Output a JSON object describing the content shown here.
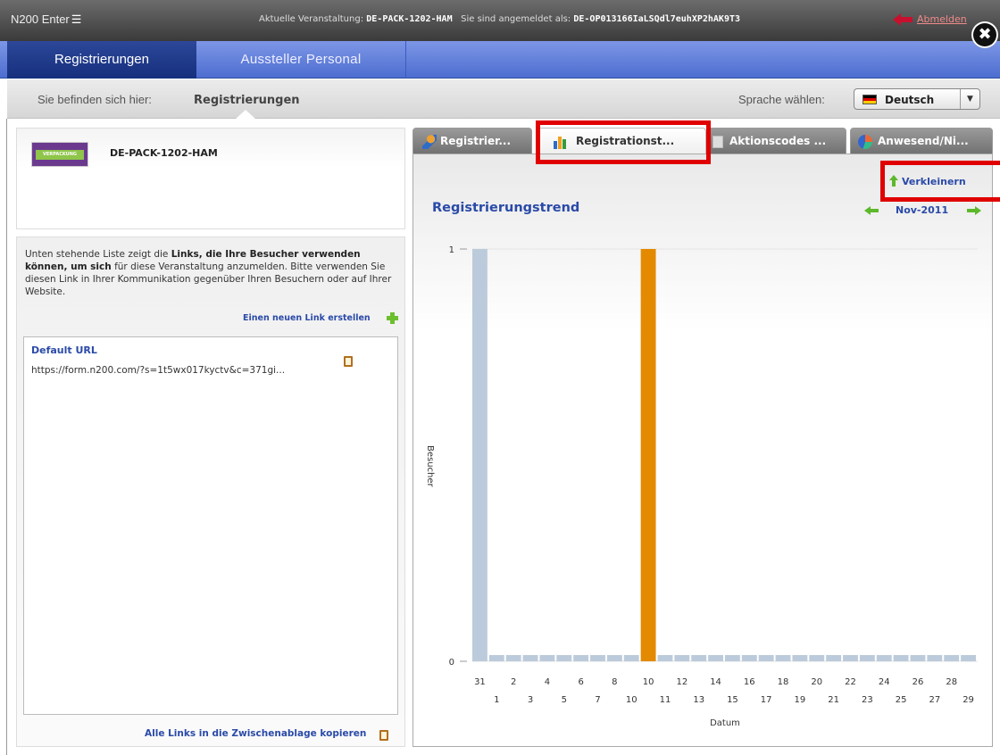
{
  "header": {
    "app_name": "N200 Enter",
    "event_label": "Aktuelle Veranstaltung:",
    "event_code": "DE-PACK-1202-HAM",
    "user_label": "Sie sind angemeldet als:",
    "user_code": "DE-OP013166IaLSQdl7euhXP2hAK9T3",
    "logout": "Abmelden",
    "close_glyph": "✖"
  },
  "nav": {
    "tabs": [
      {
        "label": "Registrierungen",
        "active": true
      },
      {
        "label": "Aussteller Personal",
        "active": false
      }
    ]
  },
  "breadcrumb": {
    "label": "Sie befinden sich hier:",
    "current": "Registrierungen"
  },
  "language": {
    "label": "Sprache wählen:",
    "value": "Deutsch"
  },
  "event_card": {
    "logo_text": "VERPACKUNG",
    "name": "DE-PACK-1202-HAM"
  },
  "links_panel": {
    "desc_part1": "Unten stehende Liste zeigt die ",
    "desc_bold": "Links, die Ihre Besucher verwenden können, um sich",
    "desc_part2": " für diese Veranstaltung anzumelden. Bitte verwenden Sie diesen Link in Ihrer Kommunikation gegenüber Ihren Besuchern oder auf Ihrer Website.",
    "new_link": "Einen neuen Link erstellen",
    "url_title": "Default URL",
    "url_value": "https://form.n200.com/?s=1t5wx017kyctv&c=371gi...",
    "copy_all": "Alle Links in die Zwischenablage kopieren"
  },
  "tabs": [
    {
      "label": "Registrier...",
      "icon": "people-icon"
    },
    {
      "label": "Registrationst...",
      "icon": "bar-chart-icon",
      "active": true
    },
    {
      "label": "Aktionscodes ...",
      "icon": "document-icon"
    },
    {
      "label": "Anwesend/Ni...",
      "icon": "pie-chart-icon"
    }
  ],
  "chart_panel": {
    "shrink_label": "Verkleinern",
    "title": "Registrierungstrend",
    "month": "Nov-2011"
  },
  "colors": {
    "accent_blue": "#2a4aa8",
    "bar_highlight": "#e38a00",
    "bar_default": "#bccbdb",
    "highlight_box": "#e00000"
  },
  "chart_data": {
    "type": "bar",
    "title": "",
    "xlabel": "Datum",
    "ylabel": "Besucher",
    "ylim": [
      0,
      1
    ],
    "y_ticks": [
      "0",
      "1"
    ],
    "categories": [
      "31",
      "1",
      "2",
      "3",
      "4",
      "5",
      "6",
      "7",
      "8",
      "10",
      "10",
      "11",
      "12",
      "13",
      "14",
      "15",
      "16",
      "17",
      "18",
      "19",
      "20",
      "21",
      "22",
      "23",
      "24",
      "25",
      "26",
      "27",
      "28",
      "29"
    ],
    "values": [
      1,
      0,
      0,
      0,
      0,
      0,
      0,
      0,
      0,
      0,
      1,
      0,
      0,
      0,
      0,
      0,
      0,
      0,
      0,
      0,
      0,
      0,
      0,
      0,
      0,
      0,
      0,
      0,
      0,
      0
    ],
    "highlight_index": 10
  }
}
